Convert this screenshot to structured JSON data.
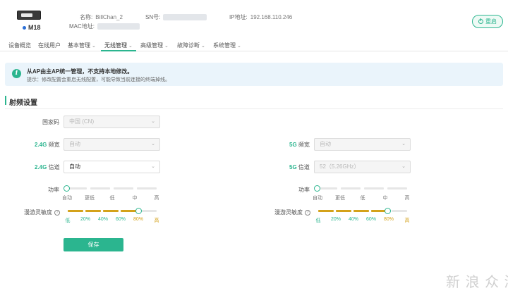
{
  "header": {
    "device_tag": "路由器",
    "model": "M18",
    "name_label": "名称:",
    "name_value": "BillChan_2",
    "sn_label": "SN号:",
    "ip_label": "IP地址:",
    "ip_value": "192.168.110.246",
    "mac_label": "MAC地址:",
    "reboot_label": "重启"
  },
  "nav": {
    "items": [
      {
        "label": "设备概览"
      },
      {
        "label": "在线用户"
      },
      {
        "label": "基本管理"
      },
      {
        "label": "无线管理"
      },
      {
        "label": "高级管理"
      },
      {
        "label": "故障诊断"
      },
      {
        "label": "系统管理"
      }
    ],
    "active": "无线管理"
  },
  "notice": {
    "title": "从AP由主AP统一管理，不支持本地修改。",
    "subtitle": "提示：修改配置会重启无线配置，可能导致当前连接的终端掉线。"
  },
  "section": {
    "title": "射频设置"
  },
  "form": {
    "country_label": "国家码",
    "country_value": "中国 (CN)",
    "band24": "2.4G",
    "band5": "5G",
    "bandwidth_label": "频宽",
    "channel_label": "信道",
    "bw24_value": "自动",
    "ch24_value": "自动",
    "bw5_value": "自动",
    "ch5_value": "52（5.26GHz）",
    "power_label": "功率",
    "power_ticks": [
      "自动",
      "更低",
      "低",
      "中",
      "高"
    ],
    "power_level": "自动",
    "roam_label": "漫游灵敏度",
    "roam_help": "?",
    "roam_ticks": [
      "低",
      "20%",
      "40%",
      "60%",
      "80%",
      "高"
    ],
    "roam_level_percent": 80,
    "save_label": "保存"
  },
  "watermark": "新 浪 众 测",
  "colors": {
    "accent": "#2bb58f",
    "gold": "#d4a21a",
    "notice_bg": "#eaf4fb"
  }
}
